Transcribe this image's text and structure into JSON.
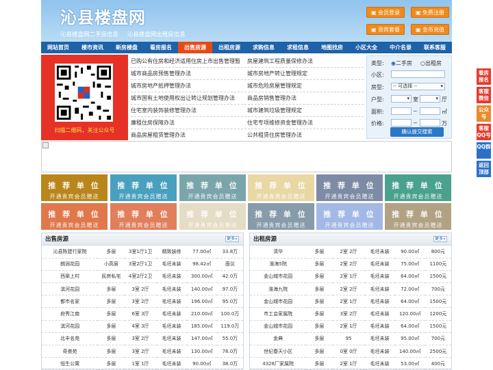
{
  "header": {
    "logo": "沁县楼盘网",
    "slogans": [
      "沁县楼盘网二手房信息",
      "沁县楼盘网出租房信息"
    ],
    "buttons": [
      {
        "icon": "user-icon",
        "label": "会员登录"
      },
      {
        "icon": "plus-icon",
        "label": "免费注册"
      },
      {
        "icon": "package-icon",
        "label": "贵宾套餐"
      },
      {
        "icon": "coin-icon",
        "label": "金币充值"
      }
    ]
  },
  "nav": [
    "网站首页",
    "楼市资讯",
    "新房楼盘",
    "看房报名",
    "出售房源",
    "出租房源",
    "求购信息",
    "求租信息",
    "地图找房",
    "小区大全",
    "中介名录",
    "联系客服"
  ],
  "qr": {
    "caption": "扫描二维码，关注公众号"
  },
  "policy_links": [
    [
      "已购公有住房和经济适用住房上市出售管理暂",
      "房屋建筑工程质量保修办法"
    ],
    [
      "城市商品房预售管理办法",
      "城市房地产转让管理规定"
    ],
    [
      "城市房地产抵押管理办法",
      "城市危险房屋管理规定"
    ],
    [
      "城市国有土地使用权出让转让规划管理办法",
      "商品房销售管理办法"
    ],
    [
      "住宅室内装饰装修管理办法",
      "城市建筑垃圾管理规定"
    ],
    [
      "廉租住房保障办法",
      "住宅专项维修资金管理办法"
    ],
    [
      "商品房屋租赁管理办法",
      "公共租赁住房管理办法"
    ]
  ],
  "search": {
    "type_label": "类型:",
    "radio_secondhand": "二手房",
    "radio_rent": "出租房",
    "community_label": "小区:",
    "housetype_label": "房型:",
    "housetype_select": "-- 可选择 --",
    "layout_label": "户型:",
    "room_unit": "室",
    "hall_unit": "厅",
    "area_label": "面积:",
    "area_unit": "㎡",
    "price_label": "价格:",
    "price_unit": "万",
    "range_sep": "~",
    "submit": "确认提交搜索"
  },
  "promo": {
    "title": "推 荐 单 位",
    "sub": "开通贵宾会员赠送",
    "colors": [
      "#b8861b",
      "#49a0be",
      "#7aa5aa",
      "#e9d7a4",
      "#7e8ba5",
      "#4aa18c",
      "#e0784c",
      "#e17f5d",
      "#e5dcc5",
      "#879baa",
      "#a4b8e6",
      "#b1a283"
    ]
  },
  "sale": {
    "title": "出售房源",
    "more": "更多»",
    "rows": [
      [
        "沁县陈建行家院",
        "多层",
        "3室1厅1卫",
        "精致装修",
        "77.00㎡",
        "33.8万"
      ],
      [
        "朗润花园",
        "小高层",
        "3室2厅1卫",
        "毛坯未装",
        "98.42㎡",
        "面议"
      ],
      [
        "西渠上村",
        "民房私宅",
        "4室2厅2卫",
        "毛坯未装",
        "300.00㎡",
        "42.0万"
      ],
      [
        "滨河花园",
        "多层",
        "3室 2厅",
        "毛坯未装",
        "140.00㎡",
        "97.0万"
      ],
      [
        "都市名家",
        "多层",
        "3室 2厅",
        "毛坯未装",
        "196.00㎡",
        "95.0万"
      ],
      [
        "府秀江南",
        "多层",
        "6室 3厅",
        "毛坯未装",
        "210.00㎡",
        "100.0万"
      ],
      [
        "滨河花园",
        "多层",
        "4室 3厅",
        "毛坯未装",
        "185.00㎡",
        "119.0万"
      ],
      [
        "北丰名苑",
        "多层",
        "3室 2厅",
        "毛坯未装",
        "147.00㎡",
        "55.0万"
      ],
      [
        "奇景苑",
        "多层",
        "3室 2厅",
        "毛坯未装",
        "130.00㎡",
        "78.0万"
      ],
      [
        "恒生公寓",
        "多层",
        "1室 1厅",
        "毛坯未装",
        "90.00㎡",
        "38.0万"
      ]
    ]
  },
  "rent": {
    "title": "出租房源",
    "more": "更多»",
    "rows": [
      [
        "清华",
        "多层",
        "2室 2厅",
        "毛坯未装",
        "90.00㎡",
        "800元"
      ],
      [
        "淮海5院",
        "多层",
        "2室 2厅",
        "毛坯未装",
        "75.00㎡",
        "1100元"
      ],
      [
        "金山城市花园",
        "多层",
        "2室 1厅",
        "毛坯未装",
        "64.00㎡",
        "1500元"
      ],
      [
        "淮海九院",
        "多层",
        "2室 2厅",
        "毛坯未装",
        "72.00㎡",
        "700元"
      ],
      [
        "金山城市花园",
        "多层",
        "2室 1厅",
        "毛坯未装",
        "64.00㎡",
        "1500元"
      ],
      [
        "市工会家属院",
        "多层",
        "3室 2厅",
        "毛坯未装",
        "120.00㎡",
        "1200元"
      ],
      [
        "金山城市花园",
        "多层",
        "2室 1厅",
        "毛坯未装",
        "64.00㎡",
        "1500元"
      ],
      [
        "金典",
        "多层",
        "95",
        "毛坯未装",
        "95.00㎡",
        "700元"
      ],
      [
        "世纪春天小区",
        "多层",
        "0室 0厅",
        "毛坯未装",
        "140.00㎡",
        "2500元"
      ],
      [
        "4328厂家属院",
        "多层",
        "2室 1厅",
        "毛坯未装",
        "53.00㎡",
        "400元"
      ]
    ]
  },
  "sidebar": [
    "看房报名",
    "客服微信",
    "公众号",
    "客服QQ号",
    "QQ群",
    "返回顶部"
  ],
  "colors": {
    "nav": "#1e62a8",
    "accent": "#ef8a1d",
    "sidebar": "#e53b2e"
  }
}
